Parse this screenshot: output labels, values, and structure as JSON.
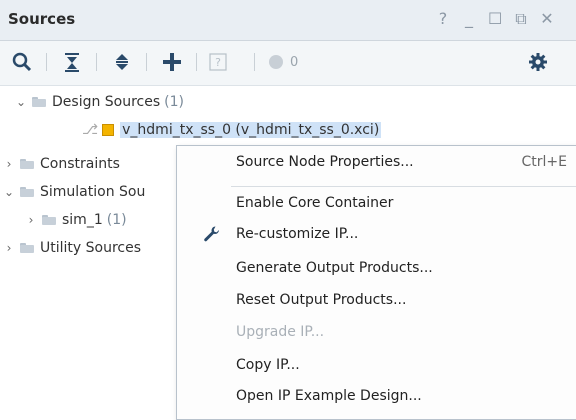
{
  "panel": {
    "title": "Sources",
    "controls": {
      "help": "?",
      "minimize": "_",
      "maximize": "☐",
      "float": "⧉",
      "close": "✕"
    }
  },
  "toolbar": {
    "search": "search-icon",
    "collapse_all": "collapse-all-icon",
    "expand_all": "expand-all-icon",
    "add": "plus-icon",
    "help": "?",
    "count": "0",
    "settings": "gear-icon"
  },
  "tree": {
    "design_sources": {
      "label": "Design Sources",
      "count": "(1)"
    },
    "ip_file": "v_hdmi_tx_ss_0 (v_hdmi_tx_ss_0.xci)",
    "constraints": "Constraints",
    "simulation": "Simulation Sou",
    "sim1": {
      "label": "sim_1",
      "count": "(1)"
    },
    "utility": "Utility Sources"
  },
  "menu": {
    "items": [
      {
        "label": "Source Node Properties...",
        "shortcut": "Ctrl+E"
      },
      {
        "label": "Enable Core Container"
      },
      {
        "label": "Re-customize IP..."
      },
      {
        "label": "Generate Output Products..."
      },
      {
        "label": "Reset Output Products..."
      },
      {
        "label": "Upgrade IP...",
        "disabled": true
      },
      {
        "label": "Copy IP..."
      },
      {
        "label": "Open IP Example Design..."
      }
    ]
  },
  "colors": {
    "header_bg": "#e9eef3",
    "selection": "#cfe2f7",
    "ip_icon": "#f4b400"
  }
}
